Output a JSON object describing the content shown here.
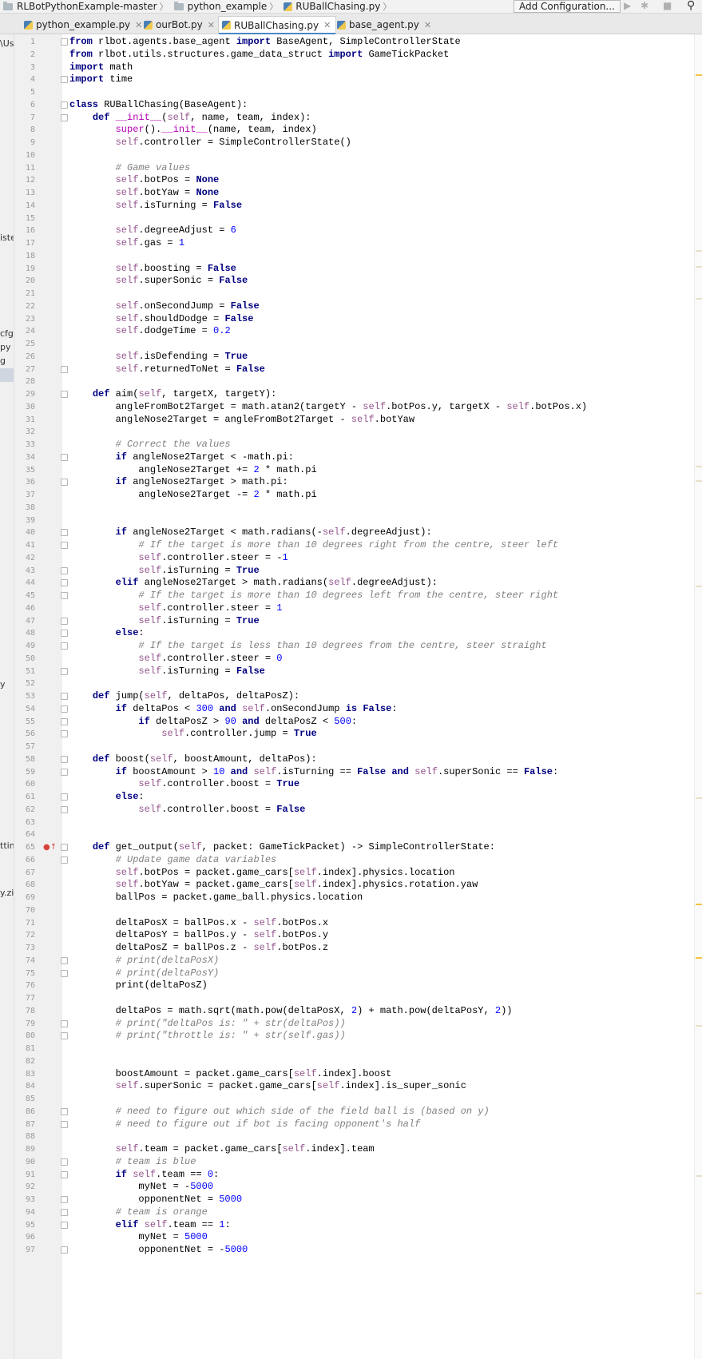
{
  "navbar": {
    "breadcrumbs": [
      "RLBotPythonExample-master",
      "python_example",
      "RUBallChasing.py"
    ],
    "run_config_label": "Add Configuration...",
    "run_icon": "play-icon",
    "debug_icon": "bug-icon",
    "stop_icon": "stop-icon",
    "search_icon": "search-icon"
  },
  "tabs": [
    {
      "label": "python_example.py",
      "active": false
    },
    {
      "label": "ourBot.py",
      "active": false
    },
    {
      "label": "RUBallChasing.py",
      "active": true
    },
    {
      "label": "base_agent.py",
      "active": false
    }
  ],
  "project_panel_fragments": [
    {
      "text": "\\Us"
    },
    {
      "text": "iste"
    },
    {
      "text": "cfg"
    },
    {
      "text": "py"
    },
    {
      "text": "g"
    },
    {
      "text": ""
    },
    {
      "text": "y"
    },
    {
      "text": "ttin"
    },
    {
      "text": "y.zip"
    }
  ],
  "colors": {
    "keyword": "#000080",
    "self": "#94558d",
    "number": "#0000ff",
    "comment": "#808080",
    "magic": "#b200b2",
    "gutter_bg": "#f0f0f0",
    "active_tab_underline": "#4a88c7",
    "scroll_marker": "#f5c242"
  },
  "editor": {
    "lines": [
      {
        "n": "1",
        "text": "from rlbot.agents.base_agent import BaseAgent, SimpleControllerState"
      },
      {
        "n": "2",
        "text": "from rlbot.utils.structures.game_data_struct import GameTickPacket"
      },
      {
        "n": "3",
        "text": "import math"
      },
      {
        "n": "4",
        "text": "import time"
      },
      {
        "n": "5",
        "text": ""
      },
      {
        "n": "6",
        "text": "class RUBallChasing(BaseAgent):"
      },
      {
        "n": "7",
        "text": "    def __init__(self, name, team, index):"
      },
      {
        "n": "8",
        "text": "        super().__init__(name, team, index)"
      },
      {
        "n": "9",
        "text": "        self.controller = SimpleControllerState()"
      },
      {
        "n": "10",
        "text": ""
      },
      {
        "n": "11",
        "text": "        # Game values"
      },
      {
        "n": "12",
        "text": "        self.botPos = None"
      },
      {
        "n": "13",
        "text": "        self.botYaw = None"
      },
      {
        "n": "14",
        "text": "        self.isTurning = False"
      },
      {
        "n": "15",
        "text": ""
      },
      {
        "n": "16",
        "text": "        self.degreeAdjust = 6"
      },
      {
        "n": "17",
        "text": "        self.gas = 1"
      },
      {
        "n": "18",
        "text": ""
      },
      {
        "n": "19",
        "text": "        self.boosting = False"
      },
      {
        "n": "20",
        "text": "        self.superSonic = False"
      },
      {
        "n": "21",
        "text": ""
      },
      {
        "n": "22",
        "text": "        self.onSecondJump = False"
      },
      {
        "n": "23",
        "text": "        self.shouldDodge = False"
      },
      {
        "n": "24",
        "text": "        self.dodgeTime = 0.2"
      },
      {
        "n": "25",
        "text": ""
      },
      {
        "n": "26",
        "text": "        self.isDefending = True"
      },
      {
        "n": "27",
        "text": "        self.returnedToNet = False"
      },
      {
        "n": "28",
        "text": ""
      },
      {
        "n": "29",
        "text": "    def aim(self, targetX, targetY):"
      },
      {
        "n": "30",
        "text": "        angleFromBot2Target = math.atan2(targetY - self.botPos.y, targetX - self.botPos.x)"
      },
      {
        "n": "31",
        "text": "        angleNose2Target = angleFromBot2Target - self.botYaw"
      },
      {
        "n": "32",
        "text": ""
      },
      {
        "n": "33",
        "text": "        # Correct the values"
      },
      {
        "n": "34",
        "text": "        if angleNose2Target < -math.pi:"
      },
      {
        "n": "35",
        "text": "            angleNose2Target += 2 * math.pi"
      },
      {
        "n": "36",
        "text": "        if angleNose2Target > math.pi:"
      },
      {
        "n": "37",
        "text": "            angleNose2Target -= 2 * math.pi"
      },
      {
        "n": "38",
        "text": ""
      },
      {
        "n": "39",
        "text": ""
      },
      {
        "n": "40",
        "text": "        if angleNose2Target < math.radians(-self.degreeAdjust):"
      },
      {
        "n": "41",
        "text": "            # If the target is more than 10 degrees right from the centre, steer left"
      },
      {
        "n": "42",
        "text": "            self.controller.steer = -1"
      },
      {
        "n": "43",
        "text": "            self.isTurning = True"
      },
      {
        "n": "44",
        "text": "        elif angleNose2Target > math.radians(self.degreeAdjust):"
      },
      {
        "n": "45",
        "text": "            # If the target is more than 10 degrees left from the centre, steer right"
      },
      {
        "n": "46",
        "text": "            self.controller.steer = 1"
      },
      {
        "n": "47",
        "text": "            self.isTurning = True"
      },
      {
        "n": "48",
        "text": "        else:"
      },
      {
        "n": "49",
        "text": "            # If the target is less than 10 degrees from the centre, steer straight"
      },
      {
        "n": "50",
        "text": "            self.controller.steer = 0"
      },
      {
        "n": "51",
        "text": "            self.isTurning = False"
      },
      {
        "n": "52",
        "text": ""
      },
      {
        "n": "53",
        "text": "    def jump(self, deltaPos, deltaPosZ):"
      },
      {
        "n": "54",
        "text": "        if deltaPos < 300 and self.onSecondJump is False:"
      },
      {
        "n": "55",
        "text": "            if deltaPosZ > 90 and deltaPosZ < 500:"
      },
      {
        "n": "56",
        "text": "                self.controller.jump = True"
      },
      {
        "n": "57",
        "text": ""
      },
      {
        "n": "58",
        "text": "    def boost(self, boostAmount, deltaPos):"
      },
      {
        "n": "59",
        "text": "        if boostAmount > 10 and self.isTurning == False and self.superSonic == False:"
      },
      {
        "n": "60",
        "text": "            self.controller.boost = True"
      },
      {
        "n": "61",
        "text": "        else:"
      },
      {
        "n": "62",
        "text": "            self.controller.boost = False"
      },
      {
        "n": "63",
        "text": ""
      },
      {
        "n": "64",
        "text": ""
      },
      {
        "n": "65",
        "text": "    def get_output(self, packet: GameTickPacket) -> SimpleControllerState:"
      },
      {
        "n": "66",
        "text": "        # Update game data variables"
      },
      {
        "n": "67",
        "text": "        self.botPos = packet.game_cars[self.index].physics.location"
      },
      {
        "n": "68",
        "text": "        self.botYaw = packet.game_cars[self.index].physics.rotation.yaw"
      },
      {
        "n": "69",
        "text": "        ballPos = packet.game_ball.physics.location"
      },
      {
        "n": "70",
        "text": ""
      },
      {
        "n": "71",
        "text": "        deltaPosX = ballPos.x - self.botPos.x"
      },
      {
        "n": "72",
        "text": "        deltaPosY = ballPos.y - self.botPos.y"
      },
      {
        "n": "73",
        "text": "        deltaPosZ = ballPos.z - self.botPos.z"
      },
      {
        "n": "74",
        "text": "        # print(deltaPosX)"
      },
      {
        "n": "75",
        "text": "        # print(deltaPosY)"
      },
      {
        "n": "76",
        "text": "        print(deltaPosZ)"
      },
      {
        "n": "77",
        "text": ""
      },
      {
        "n": "78",
        "text": "        deltaPos = math.sqrt(math.pow(deltaPosX, 2) + math.pow(deltaPosY, 2))"
      },
      {
        "n": "79",
        "text": "        # print(\"deltaPos is: \" + str(deltaPos))"
      },
      {
        "n": "80",
        "text": "        # print(\"throttle is: \" + str(self.gas))"
      },
      {
        "n": "81",
        "text": ""
      },
      {
        "n": "82",
        "text": ""
      },
      {
        "n": "83",
        "text": "        boostAmount = packet.game_cars[self.index].boost"
      },
      {
        "n": "84",
        "text": "        self.superSonic = packet.game_cars[self.index].is_super_sonic"
      },
      {
        "n": "85",
        "text": ""
      },
      {
        "n": "86",
        "text": "        # need to figure out which side of the field ball is (based on y)"
      },
      {
        "n": "87",
        "text": "        # need to figure out if bot is facing opponent's half"
      },
      {
        "n": "88",
        "text": ""
      },
      {
        "n": "89",
        "text": "        self.team = packet.game_cars[self.index].team"
      },
      {
        "n": "90",
        "text": "        # team is blue"
      },
      {
        "n": "91",
        "text": "        if self.team == 0:"
      },
      {
        "n": "92",
        "text": "            myNet = -5000"
      },
      {
        "n": "93",
        "text": "            opponentNet = 5000"
      },
      {
        "n": "94",
        "text": "        # team is orange"
      },
      {
        "n": "95",
        "text": "        elif self.team == 1:"
      },
      {
        "n": "96",
        "text": "            myNet = 5000"
      },
      {
        "n": "97",
        "text": "            opponentNet = -5000"
      }
    ],
    "fold_marker_lines": [
      1,
      4,
      6,
      7,
      27,
      29,
      34,
      36,
      40,
      41,
      43,
      44,
      45,
      47,
      48,
      49,
      51,
      53,
      54,
      55,
      56,
      58,
      59,
      61,
      62,
      65,
      66,
      74,
      75,
      79,
      80,
      86,
      87,
      90,
      91,
      93,
      94,
      95,
      97
    ],
    "override_icon_line": 65
  }
}
